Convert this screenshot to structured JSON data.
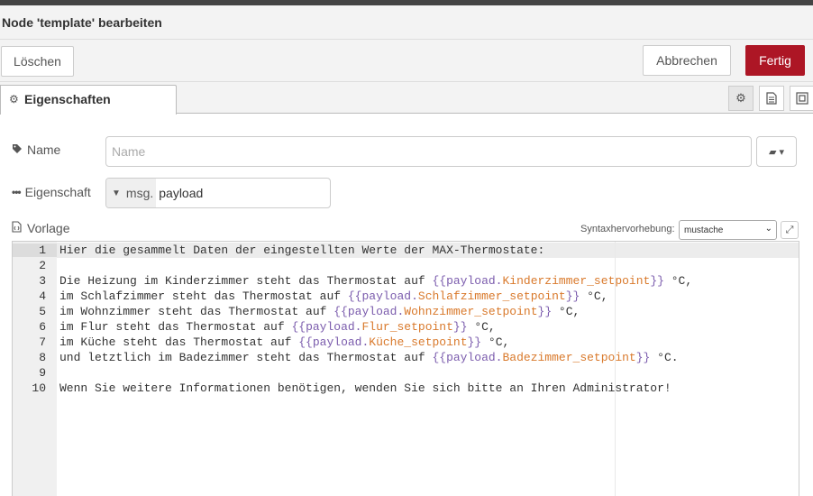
{
  "dialog": {
    "title": "Node 'template' bearbeiten"
  },
  "buttons": {
    "delete": "Löschen",
    "cancel": "Abbrechen",
    "done": "Fertig"
  },
  "tabs": [
    {
      "label": "Eigenschaften",
      "icon": "gear-icon"
    }
  ],
  "tab_icons": [
    "gear-icon",
    "file-text-icon",
    "frame-icon"
  ],
  "form": {
    "name_label": "Name",
    "name_value": "",
    "name_placeholder": "Name",
    "property_label": "Eigenschaft",
    "property_type": "msg.",
    "property_value": "payload",
    "template_label": "Vorlage",
    "syntax_label": "Syntaxhervorhebung:",
    "syntax_value": "mustache"
  },
  "editor": {
    "lines": [
      {
        "n": "1",
        "segments": [
          {
            "t": "Hier die gesammelt Daten der eingestellten Werte der MAX-Thermostate:",
            "c": ""
          }
        ]
      },
      {
        "n": "2",
        "segments": []
      },
      {
        "n": "3",
        "segments": [
          {
            "t": "Die Heizung im Kinderzimmer steht das Thermostat auf ",
            "c": ""
          },
          {
            "t": "{{",
            "c": "br"
          },
          {
            "t": "payload.",
            "c": "br"
          },
          {
            "t": "Kinderzimmer_setpoint",
            "c": "var"
          },
          {
            "t": "}}",
            "c": "br"
          },
          {
            "t": " °C,",
            "c": ""
          }
        ]
      },
      {
        "n": "4",
        "segments": [
          {
            "t": "im Schlafzimmer steht das Thermostat auf ",
            "c": ""
          },
          {
            "t": "{{",
            "c": "br"
          },
          {
            "t": "payload.",
            "c": "br"
          },
          {
            "t": "Schlafzimmer_setpoint",
            "c": "var"
          },
          {
            "t": "}}",
            "c": "br"
          },
          {
            "t": " °C,",
            "c": ""
          }
        ]
      },
      {
        "n": "5",
        "segments": [
          {
            "t": "im Wohnzimmer steht das Thermostat auf ",
            "c": ""
          },
          {
            "t": "{{",
            "c": "br"
          },
          {
            "t": "payload.",
            "c": "br"
          },
          {
            "t": "Wohnzimmer_setpoint",
            "c": "var"
          },
          {
            "t": "}}",
            "c": "br"
          },
          {
            "t": " °C,",
            "c": ""
          }
        ]
      },
      {
        "n": "6",
        "segments": [
          {
            "t": "im Flur steht das Thermostat auf ",
            "c": ""
          },
          {
            "t": "{{",
            "c": "br"
          },
          {
            "t": "payload.",
            "c": "br"
          },
          {
            "t": "Flur_setpoint",
            "c": "var"
          },
          {
            "t": "}}",
            "c": "br"
          },
          {
            "t": " °C,",
            "c": ""
          }
        ]
      },
      {
        "n": "7",
        "segments": [
          {
            "t": "im Küche steht das Thermostat auf ",
            "c": ""
          },
          {
            "t": "{{",
            "c": "br"
          },
          {
            "t": "payload.",
            "c": "br"
          },
          {
            "t": "Küche_setpoint",
            "c": "var"
          },
          {
            "t": "}}",
            "c": "br"
          },
          {
            "t": " °C,",
            "c": ""
          }
        ]
      },
      {
        "n": "8",
        "segments": [
          {
            "t": "und letztlich im Badezimmer steht das Thermostat auf ",
            "c": ""
          },
          {
            "t": "{{",
            "c": "br"
          },
          {
            "t": "payload.",
            "c": "br"
          },
          {
            "t": "Badezimmer_setpoint",
            "c": "var"
          },
          {
            "t": "}}",
            "c": "br"
          },
          {
            "t": " °C.",
            "c": ""
          }
        ]
      },
      {
        "n": "9",
        "segments": []
      },
      {
        "n": "10",
        "segments": [
          {
            "t": "Wenn Sie weitere Informationen benötigen, wenden Sie sich bitte an Ihren Administrator!",
            "c": ""
          }
        ]
      }
    ]
  },
  "colors": {
    "done_button": "#ad1625",
    "mustache_brace": "#7b5cad",
    "mustache_variable": "#d9792b"
  }
}
